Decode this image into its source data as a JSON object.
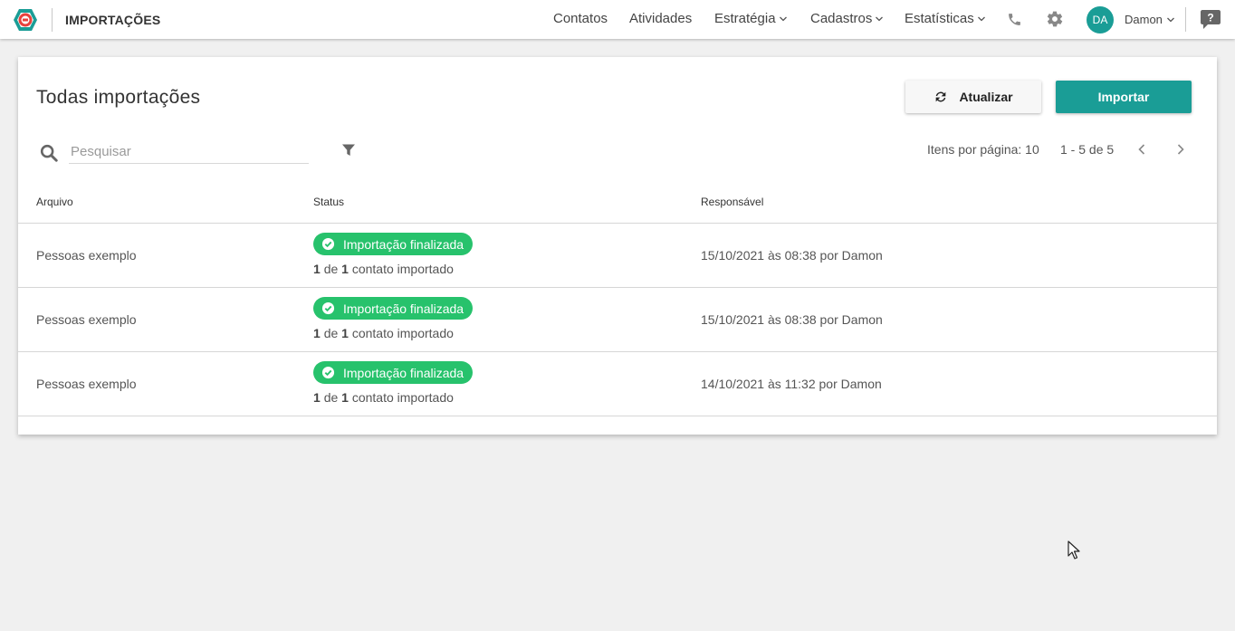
{
  "header": {
    "title": "IMPORTAÇÕES",
    "nav": [
      {
        "label": "Contatos"
      },
      {
        "label": "Atividades"
      },
      {
        "label": "Estratégia"
      },
      {
        "label": "Cadastros"
      },
      {
        "label": "Estatísticas"
      }
    ],
    "user": {
      "initials": "DA",
      "name": "Damon"
    },
    "icons": [
      "logo-icon",
      "phone-icon",
      "gear-icon",
      "help-icon"
    ]
  },
  "card": {
    "title": "Todas importações",
    "refresh_label": "Atualizar",
    "import_label": "Importar",
    "search_placeholder": "Pesquisar",
    "per_page": "Itens por página: 10",
    "range": "1 - 5 de 5"
  },
  "table": {
    "headers": {
      "file": "Arquivo",
      "status": "Status",
      "responsible": "Responsável"
    },
    "rows": [
      {
        "file": "Pessoas exemplo",
        "status": "Importação finalizada",
        "count_done": "1",
        "count_of": "de",
        "count_total": "1",
        "count_suffix": "contato importado",
        "responsible": "15/10/2021 às 08:38 por Damon"
      },
      {
        "file": "Pessoas exemplo",
        "status": "Importação finalizada",
        "count_done": "1",
        "count_of": "de",
        "count_total": "1",
        "count_suffix": "contato importado",
        "responsible": "15/10/2021 às 08:38 por Damon"
      },
      {
        "file": "Pessoas exemplo",
        "status": "Importação finalizada",
        "count_done": "1",
        "count_of": "de",
        "count_total": "1",
        "count_suffix": "contato importado",
        "responsible": "14/10/2021 às 11:32 por Damon"
      }
    ]
  },
  "colors": {
    "accent": "#1a9d96",
    "success": "#27c26c",
    "logo": "#e8413c",
    "background": "#f0f0f0"
  }
}
